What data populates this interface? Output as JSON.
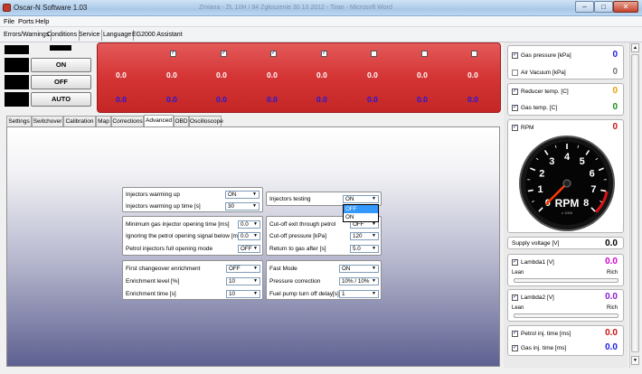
{
  "window": {
    "title": "Oscar-N Software 1.03",
    "ghost_title": "Zmiana - ZŁ 10H / 84 Zgłoszenie 30 10 2012 - Tiran - Microsoft Word"
  },
  "menu": [
    "File",
    "Ports",
    "Help"
  ],
  "toolbar": [
    "Errors/Warnings",
    "Conditions",
    "Service",
    "Language",
    "EG2000 Assistant"
  ],
  "mode_buttons": {
    "on": "ON",
    "off": "OFF",
    "auto": "AUTO"
  },
  "red_panel": {
    "check": "✓",
    "row1": [
      "0.0",
      "0.0",
      "0.0",
      "0.0",
      "0.0",
      "0.0",
      "0.0",
      "0.0"
    ],
    "row2": [
      "0.0",
      "0.0",
      "0.0",
      "0.0",
      "0.0",
      "0.0",
      "0.0",
      "0.0"
    ],
    "colors": {
      "row1": "#ffffff",
      "row2": "#1a1ae6"
    }
  },
  "tabs": [
    "Settings",
    "Switchover",
    "Calibration",
    "Map",
    "Corrections",
    "Advanced",
    "OBD",
    "Oscilloscope"
  ],
  "active_tab": "Advanced",
  "advanced": {
    "g1": [
      {
        "label": "Injectors warming up",
        "value": "ON"
      },
      {
        "label": "Injectors warming up time [s]",
        "value": "30"
      }
    ],
    "g2": [
      {
        "label": "Injectors testing",
        "value": "ON"
      }
    ],
    "g3": [
      {
        "label": "Minimum gas injector opening time [ms]",
        "value": "0.0"
      },
      {
        "label": "Ignoring the petrol opening signal below [ms]",
        "value": "0.0"
      },
      {
        "label": "Petrol injectors full opening mode",
        "value": "OFF"
      }
    ],
    "g4": [
      {
        "label": "Cut-off exit through petrol",
        "value": "OFF"
      },
      {
        "label": "Cut-off pressure [kPa]",
        "value": "120"
      },
      {
        "label": "Return to gas after [s]",
        "value": "5.0"
      }
    ],
    "g5": [
      {
        "label": "First changeover enrichment",
        "value": "OFF"
      },
      {
        "label": "Enrichment level [%]",
        "value": "10"
      },
      {
        "label": "Enrichment time [s]",
        "value": "10"
      }
    ],
    "g6": [
      {
        "label": "Fast Mode",
        "value": "ON"
      },
      {
        "label": "Pressure correction",
        "value": "10% / 10%"
      },
      {
        "label": "Fuel pump turn off delay[s]",
        "value": "1"
      }
    ],
    "dropdown_options": [
      "OFF",
      "ON"
    ]
  },
  "right": {
    "check": "✓",
    "gas_pressure": {
      "label": "Gas pressure [kPa]",
      "value": "0",
      "color": "#1a1ae6"
    },
    "air_vacuum": {
      "label": "Air Vacuum [kPa]",
      "value": "0",
      "color": "#777777"
    },
    "reducer_temp": {
      "label": "Reducer temp. [C]",
      "value": "0",
      "color": "#e6a000"
    },
    "gas_temp": {
      "label": "Gas temp. [C]",
      "value": "0",
      "color": "#109010"
    },
    "rpm": {
      "label": "RPM",
      "value": "0",
      "color": "#cc1010",
      "dial": [
        "0",
        "1",
        "2",
        "3",
        "4",
        "5",
        "6",
        "7",
        "8"
      ],
      "unit": "RPM",
      "scale": "x 1000"
    },
    "supply": {
      "label": "Supply voltage [V]",
      "value": "0.0"
    },
    "lambda1": {
      "label": "Lambda1 [V]",
      "value": "0.0",
      "lean": "Lean",
      "rich": "Rich",
      "color": "#d100d1"
    },
    "lambda2": {
      "label": "Lambda2 [V]",
      "value": "0.0",
      "lean": "Lean",
      "rich": "Rich",
      "color": "#8a1ad1"
    },
    "petrol_inj": {
      "label": "Petrol inj. time [ms]",
      "value": "0.0",
      "color": "#cc1010"
    },
    "gas_inj": {
      "label": "Gas inj. time [ms]",
      "value": "0.0",
      "color": "#1a1ae6"
    }
  }
}
